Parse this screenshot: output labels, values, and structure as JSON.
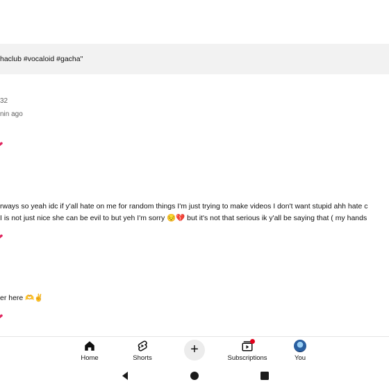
{
  "search": {
    "query": "haclub #vocaloid #gacha\""
  },
  "comment_meta": {
    "count": "32",
    "time": "nin ago"
  },
  "comments": [
    {
      "text": "rways so yeah idc if y'all hate on me for random things I'm just trying to make videos I don't want stupid ahh hate c"
    },
    {
      "text": "I is not just nice she can be evil to but yeh I'm sorry 😔💔 but it's not that serious  ik y'all be saying that ( my hands"
    },
    {
      "text": "er here 🫶✌"
    }
  ],
  "reaction_icon": "heart-icon",
  "nav": {
    "items": [
      {
        "label": "Home",
        "icon": "home-icon"
      },
      {
        "label": "Shorts",
        "icon": "shorts-icon"
      },
      {
        "label": "",
        "icon": "plus-icon"
      },
      {
        "label": "Subscriptions",
        "icon": "subscriptions-icon"
      },
      {
        "label": "You",
        "icon": "avatar"
      }
    ]
  },
  "colors": {
    "accent": "#e1001b",
    "search_bg": "#f2f2f2",
    "text": "#0f0f0f",
    "secondary": "#606060"
  }
}
